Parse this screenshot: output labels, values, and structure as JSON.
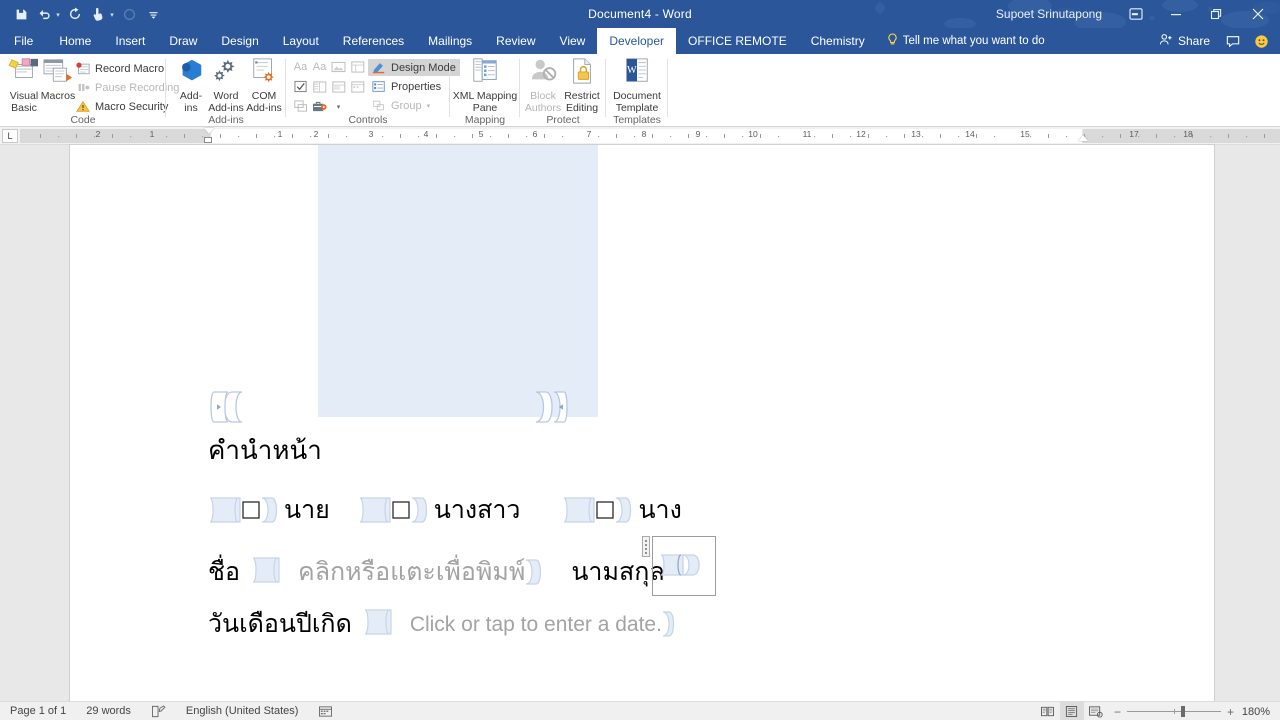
{
  "titlebar": {
    "document_title": "Document4  -  Word",
    "account_name": "Supoet Srinutapong",
    "quick_access": [
      {
        "name": "save-icon",
        "glyph": "💾"
      },
      {
        "name": "undo-icon",
        "glyph": "↶"
      },
      {
        "name": "redo-icon",
        "glyph": "↻"
      },
      {
        "name": "touch-mode-icon",
        "glyph": "☞"
      },
      {
        "name": "repeat-circle-icon",
        "glyph": "◯"
      },
      {
        "name": "customize-qat-icon",
        "glyph": "≡"
      }
    ],
    "window_controls": [
      {
        "name": "ribbon-display-options-icon",
        "glyph": "⬒"
      },
      {
        "name": "minimize-icon",
        "glyph": "─"
      },
      {
        "name": "restore-icon",
        "glyph": "❐"
      },
      {
        "name": "close-icon",
        "glyph": "✕"
      }
    ]
  },
  "tabs": [
    {
      "label": "File",
      "active": false
    },
    {
      "label": "Home",
      "active": false
    },
    {
      "label": "Insert",
      "active": false
    },
    {
      "label": "Draw",
      "active": false
    },
    {
      "label": "Design",
      "active": false
    },
    {
      "label": "Layout",
      "active": false
    },
    {
      "label": "References",
      "active": false
    },
    {
      "label": "Mailings",
      "active": false
    },
    {
      "label": "Review",
      "active": false
    },
    {
      "label": "View",
      "active": false
    },
    {
      "label": "Developer",
      "active": true
    },
    {
      "label": "OFFICE REMOTE",
      "active": false
    },
    {
      "label": "Chemistry",
      "active": false
    }
  ],
  "tellme": {
    "placeholder": "Tell me what you want to do",
    "icon": "lightbulb-icon"
  },
  "tabstrip_right": {
    "share_label": "Share",
    "share_icon": "share-person-icon",
    "comments_icon": "comment-bubble-icon",
    "feedback_icon": "smiley-face-icon"
  },
  "ribbon": {
    "groups": [
      {
        "name": "Code",
        "label": "Code",
        "big_buttons": [
          {
            "label_line1": "Visual",
            "label_line2": "Basic",
            "icon": "visual-basic-icon",
            "dim": false
          },
          {
            "label_line1": "Macros",
            "label_line2": "",
            "icon": "macros-icon",
            "dim": false
          }
        ],
        "small_buttons": [
          {
            "label": "Record Macro",
            "icon": "record-macro-icon",
            "dim": false
          },
          {
            "label": "Pause Recording",
            "icon": "pause-recording-icon",
            "dim": true
          },
          {
            "label": "Macro Security",
            "icon": "macro-security-warning-icon",
            "dim": false
          }
        ]
      },
      {
        "name": "Add-ins",
        "label": "Add-ins",
        "big_buttons": [
          {
            "label_line1": "Add-",
            "label_line2": "ins",
            "icon": "store-addins-icon",
            "dim": false
          },
          {
            "label_line1": "Word",
            "label_line2": "Add-ins",
            "icon": "word-addins-gear-icon",
            "dim": false
          },
          {
            "label_line1": "COM",
            "label_line2": "Add-ins",
            "icon": "com-addins-icon",
            "dim": false
          }
        ],
        "small_buttons": []
      },
      {
        "name": "Controls",
        "label": "Controls",
        "big_buttons": [],
        "small_buttons": [
          {
            "label": "Design Mode",
            "icon": "design-mode-icon",
            "dim": false,
            "selected": true
          },
          {
            "label": "Properties",
            "icon": "properties-icon",
            "dim": false,
            "selected": false
          },
          {
            "label": "Group",
            "icon": "group-icon",
            "dim": true,
            "selected": false,
            "caret": true
          }
        ],
        "control_gallery": [
          {
            "name": "rich-text-control-icon",
            "glyph": "Aa",
            "dim": true
          },
          {
            "name": "plain-text-control-icon",
            "glyph": "Aa",
            "dim": true
          },
          {
            "name": "picture-control-icon",
            "glyph": "▣",
            "dim": true
          },
          {
            "name": "building-block-gallery-icon",
            "glyph": "▦",
            "dim": true
          },
          {
            "name": "check-box-control-icon",
            "glyph": "☑",
            "dim": false
          },
          {
            "name": "combo-box-control-icon",
            "glyph": "▤",
            "dim": true
          },
          {
            "name": "drop-down-list-control-icon",
            "glyph": "▥",
            "dim": true
          },
          {
            "name": "date-picker-control-icon",
            "glyph": "▧",
            "dim": true
          },
          {
            "name": "repeating-section-control-icon",
            "glyph": "▨",
            "dim": true
          },
          {
            "name": "legacy-tools-icon",
            "glyph": "⚙",
            "dim": false,
            "caret": true
          }
        ]
      },
      {
        "name": "Mapping",
        "label": "Mapping",
        "big_buttons": [
          {
            "label_line1": "XML Mapping",
            "label_line2": "Pane",
            "icon": "xml-mapping-pane-icon",
            "dim": false
          }
        ],
        "small_buttons": []
      },
      {
        "name": "Protect",
        "label": "Protect",
        "big_buttons": [
          {
            "label_line1": "Block",
            "label_line2": "Authors",
            "icon": "block-authors-icon",
            "dim": true,
            "caret": true
          },
          {
            "label_line1": "Restrict",
            "label_line2": "Editing",
            "icon": "restrict-editing-icon",
            "dim": false
          }
        ],
        "small_buttons": []
      },
      {
        "name": "Templates",
        "label": "Templates",
        "big_buttons": [
          {
            "label_line1": "Document",
            "label_line2": "Template",
            "icon": "document-template-icon",
            "dim": false
          }
        ],
        "small_buttons": []
      }
    ]
  },
  "ruler": {
    "corner_label": "L",
    "left_numbers": [
      "2",
      "1"
    ],
    "right_numbers": [
      "1",
      "2",
      "3",
      "4",
      "5",
      "6",
      "7",
      "8",
      "9",
      "10",
      "11",
      "12",
      "13",
      "14",
      "15",
      "17",
      "18"
    ]
  },
  "document": {
    "picture_control": {
      "name": "picture-content-control",
      "alt": ""
    },
    "heading": "คำนำหน้า",
    "checkbox_row": [
      {
        "label": "นาย",
        "checked": false
      },
      {
        "label": "นางสาว",
        "checked": false
      },
      {
        "label": "นาง",
        "checked": false
      }
    ],
    "name_row": {
      "first_name_label": "ชื่อ",
      "first_name_placeholder": "คลิกหรือแตะเพื่อพิมพ์",
      "last_name_label": "นามสกุล",
      "last_name_value": "",
      "last_name_selected": true
    },
    "date_row": {
      "label": "วันเดือนปีเกิด",
      "placeholder": "Click or tap to enter a date."
    }
  },
  "statusbar": {
    "page": "Page 1 of 1",
    "words": "29 words",
    "proofing_icon": "proofing-errors-icon",
    "language": "English (United States)",
    "accessibility_icon": "accessibility-checker-icon",
    "views": [
      {
        "name": "read-mode-view-button",
        "glyph": "▤",
        "active": false
      },
      {
        "name": "print-layout-view-button",
        "glyph": "▤",
        "active": true
      },
      {
        "name": "web-layout-view-button",
        "glyph": "▤",
        "active": false
      }
    ],
    "zoom_out": "−",
    "zoom_in": "+",
    "zoom_level": "180%"
  },
  "colors": {
    "word_blue": "#2b579a",
    "control_fill": "#e4ecf8",
    "control_tag": "#b9c8e0",
    "workspace": "#e8e8e8"
  }
}
